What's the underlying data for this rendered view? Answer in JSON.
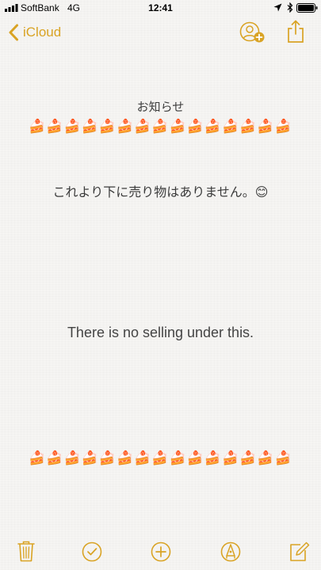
{
  "status_bar": {
    "carrier": "SoftBank",
    "network": "4G",
    "time": "12:41",
    "icons": [
      "signal-icon",
      "location-icon",
      "bluetooth-icon",
      "battery-icon"
    ]
  },
  "nav": {
    "back_label": "iCloud",
    "icons": [
      "chevron-left-icon",
      "add-person-icon",
      "share-icon"
    ]
  },
  "note": {
    "title": "お知らせ",
    "cake_row_top": "🍰🍰🍰🍰🍰🍰🍰🍰🍰🍰🍰🍰🍰🍰🍰",
    "japanese_message": "これより下に売り物はありません。😊",
    "english_message": "There is no selling under this.",
    "cake_row_bottom": "🍰🍰🍰🍰🍰🍰🍰🍰🍰🍰🍰🍰🍰🍰🍰"
  },
  "toolbar": {
    "icons": [
      "trash-icon",
      "checklist-icon",
      "plus-circle-icon",
      "markup-pen-icon",
      "compose-icon"
    ]
  },
  "colors": {
    "accent": "#d9a324",
    "background": "#f4f3f1",
    "text": "#3b3b3b"
  }
}
